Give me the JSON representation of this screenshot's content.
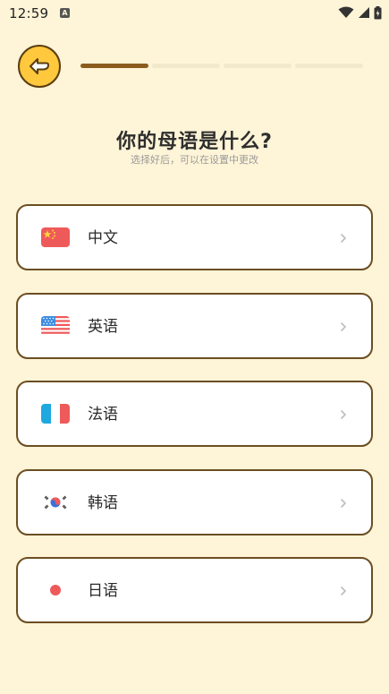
{
  "status_bar": {
    "time": "12:59",
    "notification_icon": "a-icon",
    "icons": [
      "wifi-icon",
      "signal-icon",
      "battery-icon"
    ]
  },
  "header": {
    "back_icon": "back-arrow-icon",
    "progress": {
      "completed_steps": 1,
      "total_steps": 4
    }
  },
  "title": "你的母语是什么?",
  "subtitle": "选择好后，可以在设置中更改",
  "languages": [
    {
      "label": "中文",
      "flag": "cn-flag-icon"
    },
    {
      "label": "英语",
      "flag": "us-flag-icon"
    },
    {
      "label": "法语",
      "flag": "fr-flag-icon"
    },
    {
      "label": "韩语",
      "flag": "kr-flag-icon"
    },
    {
      "label": "日语",
      "flag": "jp-flag-icon"
    }
  ],
  "colors": {
    "background": "#FEF4D7",
    "accent": "#FFC83D",
    "border": "#6B4E22",
    "progress_done": "#8A5C1E",
    "progress_todo": "#F2E8CC"
  }
}
